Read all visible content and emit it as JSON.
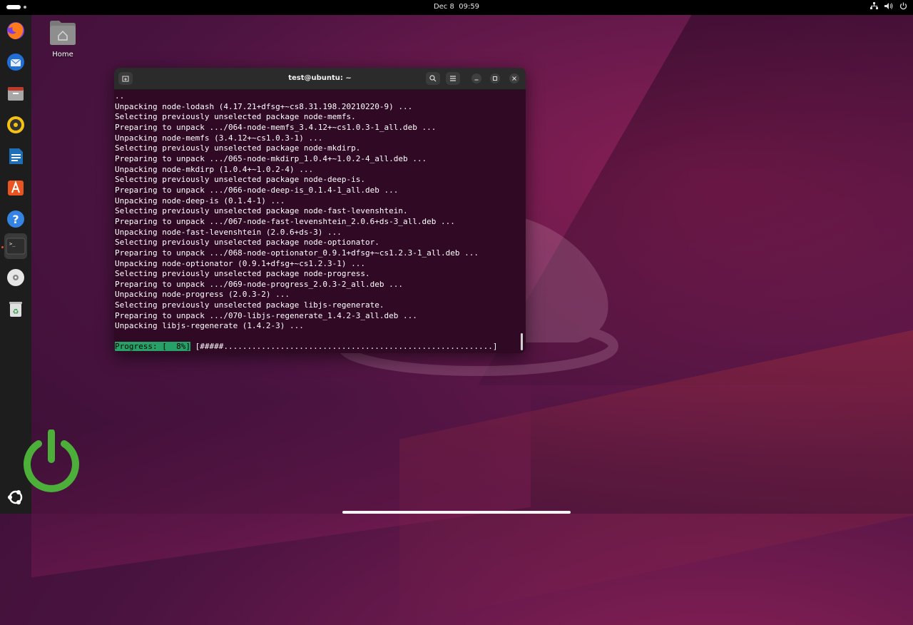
{
  "topbar": {
    "date": "Dec 8",
    "time": "09:59"
  },
  "dock": {
    "items": [
      {
        "name": "firefox",
        "icon": "firefox-icon"
      },
      {
        "name": "thunderbird",
        "icon": "thunderbird-icon"
      },
      {
        "name": "files",
        "icon": "files-icon"
      },
      {
        "name": "rhythmbox",
        "icon": "rhythmbox-icon"
      },
      {
        "name": "libreoffice-writer",
        "icon": "writer-icon"
      },
      {
        "name": "app-center",
        "icon": "app-center-icon"
      },
      {
        "name": "help",
        "icon": "help-icon"
      },
      {
        "name": "terminal",
        "icon": "terminal-icon"
      },
      {
        "name": "disc",
        "icon": "disc-icon"
      },
      {
        "name": "trash",
        "icon": "trash-icon"
      },
      {
        "name": "show-apps",
        "icon": "ubuntu-icon"
      }
    ]
  },
  "desktop": {
    "home_label": "Home"
  },
  "terminal": {
    "title": "test@ubuntu: ~",
    "lines": [
      "..",
      "Unpacking node-lodash (4.17.21+dfsg+~cs8.31.198.20210220-9) ...",
      "Selecting previously unselected package node-memfs.",
      "Preparing to unpack .../064-node-memfs_3.4.12+~cs1.0.3-1_all.deb ...",
      "Unpacking node-memfs (3.4.12+~cs1.0.3-1) ...",
      "Selecting previously unselected package node-mkdirp.",
      "Preparing to unpack .../065-node-mkdirp_1.0.4+~1.0.2-4_all.deb ...",
      "Unpacking node-mkdirp (1.0.4+~1.0.2-4) ...",
      "Selecting previously unselected package node-deep-is.",
      "Preparing to unpack .../066-node-deep-is_0.1.4-1_all.deb ...",
      "Unpacking node-deep-is (0.1.4-1) ...",
      "Selecting previously unselected package node-fast-levenshtein.",
      "Preparing to unpack .../067-node-fast-levenshtein_2.0.6+ds-3_all.deb ...",
      "Unpacking node-fast-levenshtein (2.0.6+ds-3) ...",
      "Selecting previously unselected package node-optionator.",
      "Preparing to unpack .../068-node-optionator_0.9.1+dfsg+~cs1.2.3-1_all.deb ...",
      "Unpacking node-optionator (0.9.1+dfsg+~cs1.2.3-1) ...",
      "Selecting previously unselected package node-progress.",
      "Preparing to unpack .../069-node-progress_2.0.3-2_all.deb ...",
      "Unpacking node-progress (2.0.3-2) ...",
      "Selecting previously unselected package libjs-regenerate.",
      "Preparing to unpack .../070-libjs-regenerate_1.4.2-3_all.deb ...",
      "Unpacking libjs-regenerate (1.4.2-3) ..."
    ],
    "progress_label": "Progress: [  8%]",
    "progress_bar": " [#####.........................................................]",
    "progress_percent": 8
  },
  "colors": {
    "terminal_bg": "#300a24",
    "progress_highlight": "#26a269",
    "accent": "#e95420"
  }
}
